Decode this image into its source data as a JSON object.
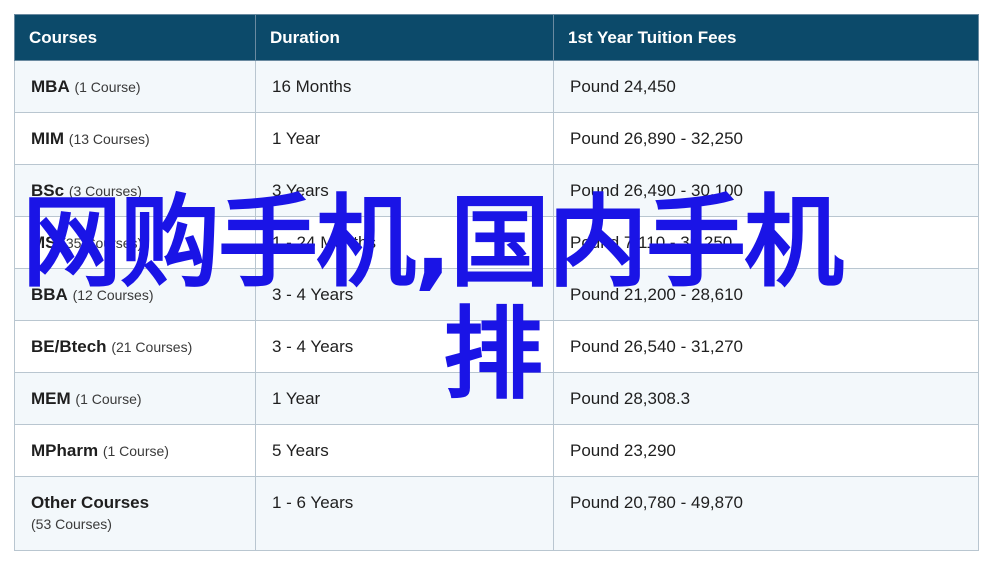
{
  "table": {
    "headers": [
      "Courses",
      "Duration",
      "1st Year Tuition Fees"
    ],
    "rows": [
      {
        "name": "MBA",
        "count": "(1 Course)",
        "duration": "16 Months",
        "fee": "Pound 24,450"
      },
      {
        "name": "MIM",
        "count": "(13 Courses)",
        "duration": "1 Year",
        "fee": "Pound 26,890 - 32,250"
      },
      {
        "name": "BSc",
        "count": "(3 Courses)",
        "duration": "3 Years",
        "fee": "Pound 26,490 - 30,100"
      },
      {
        "name": "MS",
        "count": "(35 Courses)",
        "duration": "1 - 24 Months",
        "fee": "Pound 7,110 - 32,250"
      },
      {
        "name": "BBA",
        "count": "(12 Courses)",
        "duration": "3 - 4 Years",
        "fee": "Pound 21,200 - 28,610"
      },
      {
        "name": "BE/Btech",
        "count": "(21 Courses)",
        "duration": "3 - 4 Years",
        "fee": "Pound 26,540 - 31,270"
      },
      {
        "name": "MEM",
        "count": "(1 Course)",
        "duration": "1 Year",
        "fee": "Pound 28,308.3"
      },
      {
        "name": "MPharm",
        "count": "(1 Course)",
        "duration": "5 Years",
        "fee": "Pound 23,290"
      },
      {
        "name": "Other Courses",
        "count": "(53 Courses)",
        "duration": "1 - 6 Years",
        "fee": "Pound 20,780 - 49,870"
      }
    ]
  },
  "overlay": {
    "line1": "网购手机,国内手机",
    "line2": "排"
  },
  "colors": {
    "header_bg": "#0c4a6a",
    "overlay_text": "#1a14e6",
    "row_alt": "#f3f8fb"
  }
}
